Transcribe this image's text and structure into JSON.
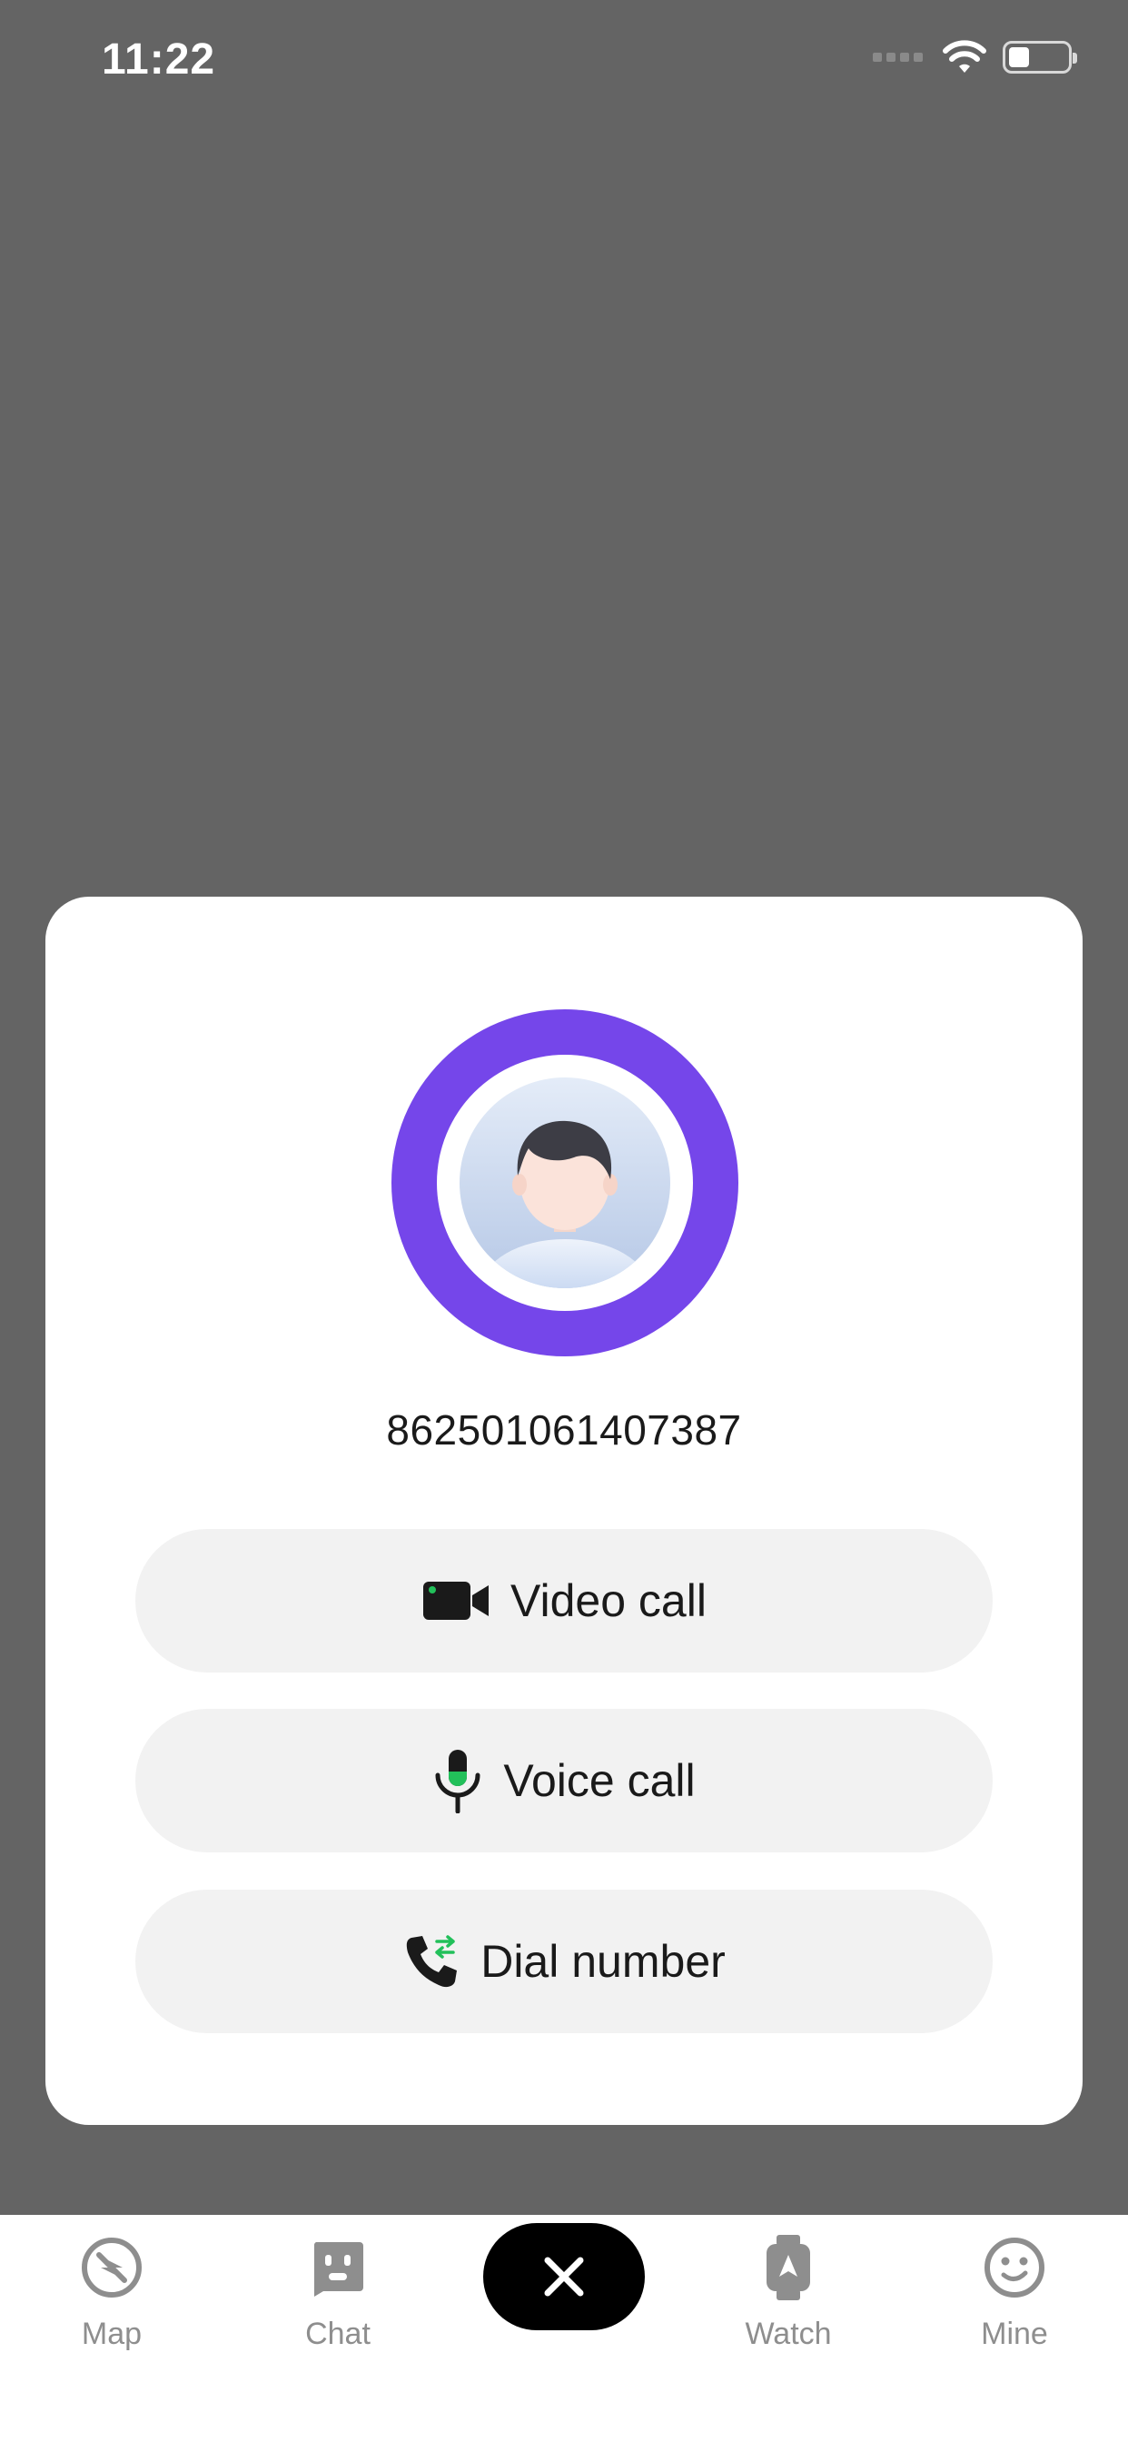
{
  "status_bar": {
    "time": "11:22",
    "icons": [
      "signal-dots-icon",
      "wifi-icon",
      "battery-icon"
    ]
  },
  "dialog": {
    "device_id": "862501061407387",
    "ring_color": "#7546ea",
    "buttons": {
      "video_call": "Video call",
      "voice_call": "Voice call",
      "dial_number": "Dial number"
    },
    "accent_green": "#22c05a"
  },
  "tabbar": {
    "tabs": [
      {
        "label": "Map",
        "icon": "compass-icon"
      },
      {
        "label": "Chat",
        "icon": "chat-face-icon"
      },
      {
        "label": "Watch",
        "icon": "watch-icon"
      },
      {
        "label": "Mine",
        "icon": "smiley-icon"
      }
    ],
    "center_button_icon": "close-icon"
  }
}
